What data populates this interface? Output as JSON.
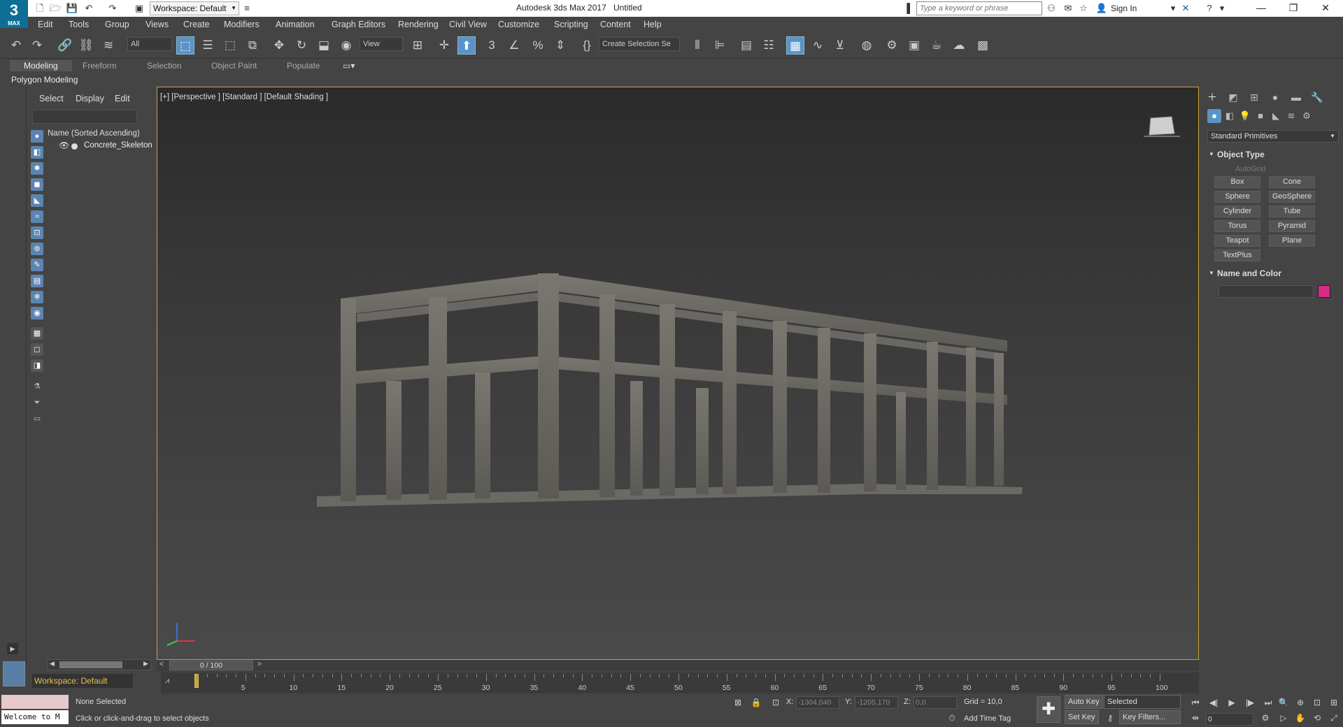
{
  "titlebar": {
    "logo_text": "3",
    "logo_sub": "MAX",
    "workspace": "Workspace: Default",
    "app_title": "Autodesk 3ds Max 2017",
    "doc_title": "Untitled",
    "search_placeholder": "Type a keyword or phrase",
    "sign_in": "Sign In"
  },
  "menu": [
    "Edit",
    "Tools",
    "Group",
    "Views",
    "Create",
    "Modifiers",
    "Animation",
    "Graph Editors",
    "Rendering",
    "Civil View",
    "Customize",
    "Scripting",
    "Content",
    "Help"
  ],
  "toolbar": {
    "selection_filter": "All",
    "ref_coord": "View",
    "named_selection": "Create Selection Se"
  },
  "ribbon": {
    "tabs": [
      "Modeling",
      "Freeform",
      "Selection",
      "Object Paint",
      "Populate"
    ],
    "active_tab": "Modeling",
    "panel": "Polygon Modeling"
  },
  "explorer": {
    "tabs": [
      "Select",
      "Display",
      "Edit"
    ],
    "column_header": "Name (Sorted Ascending)",
    "items": [
      {
        "name": "Concrete_Skeleton"
      }
    ],
    "workspace_label": "Workspace: Default"
  },
  "viewport": {
    "label": "[+] [Perspective ] [Standard ] [Default Shading ]",
    "object_name": "Concrete_Skeleton"
  },
  "command_panel": {
    "category_dropdown": "Standard Primitives",
    "object_type_title": "Object Type",
    "autogrid_label": "AutoGrid",
    "buttons": [
      "Box",
      "Cone",
      "Sphere",
      "GeoSphere",
      "Cylinder",
      "Tube",
      "Torus",
      "Pyramid",
      "Teapot",
      "Plane",
      "TextPlus"
    ],
    "name_color_title": "Name and Color",
    "object_color": "#d72b87"
  },
  "timeline": {
    "slider_label": "0 / 100",
    "frame_labels": [
      "5",
      "10",
      "15",
      "20",
      "25",
      "30",
      "35",
      "40",
      "45",
      "50",
      "55",
      "60",
      "65",
      "70",
      "75",
      "80",
      "85",
      "90",
      "95",
      "100"
    ]
  },
  "status": {
    "maxscript_text": "Welcome to M",
    "selection": "None Selected",
    "prompt": "Click or click-and-drag to select objects",
    "x_label": "X:",
    "x_value": "-1304,040",
    "y_label": "Y:",
    "y_value": "-1205,170",
    "z_label": "Z:",
    "z_value": "0,0",
    "grid": "Grid = 10,0",
    "add_time_tag": "Add Time Tag",
    "auto_key": "Auto Key",
    "set_key": "Set Key",
    "key_mode_value": "Selected",
    "key_filters": "Key Filters...",
    "current_frame": "0"
  }
}
